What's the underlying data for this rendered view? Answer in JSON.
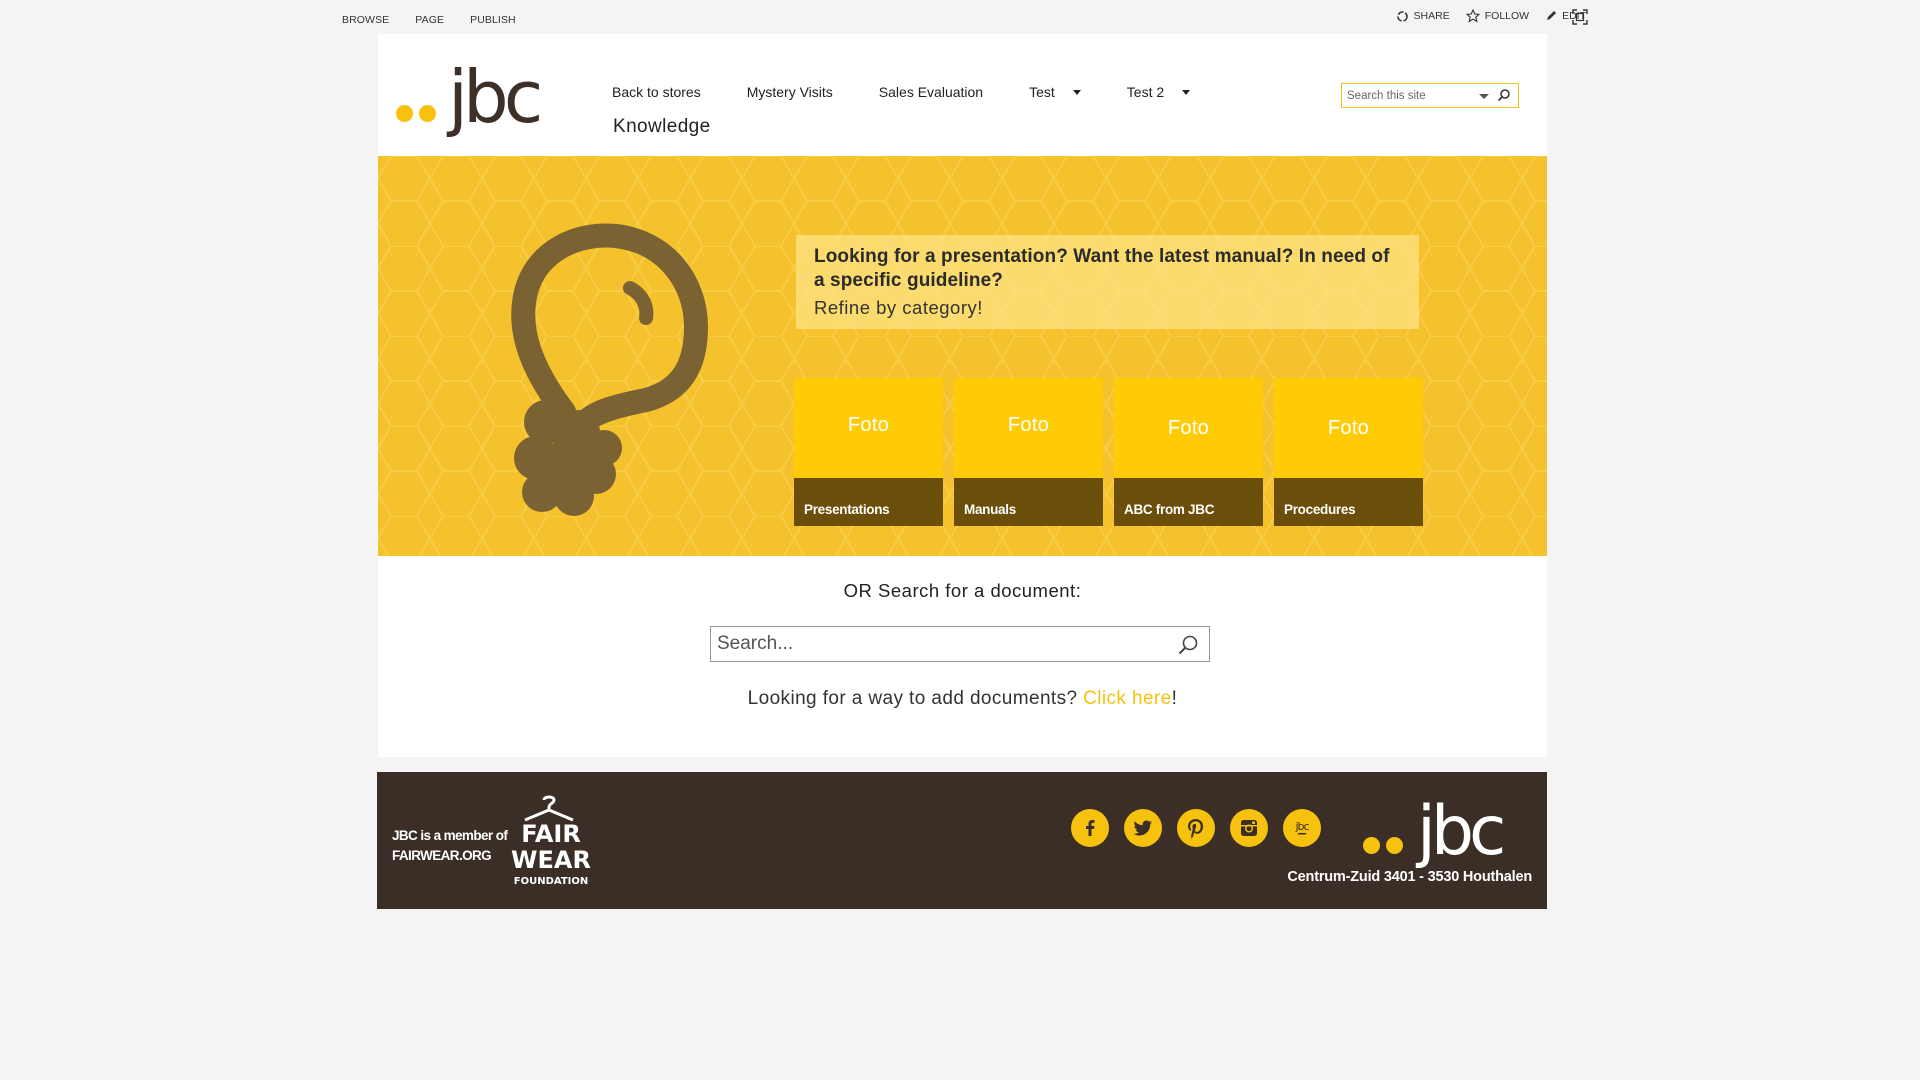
{
  "ribbon": {
    "tabs": [
      "BROWSE",
      "PAGE",
      "PUBLISH"
    ],
    "share_label": "SHARE",
    "follow_label": "FOLLOW",
    "edit_label": "EDIT"
  },
  "header": {
    "logo_text": "jbc",
    "nav": {
      "back_to_stores": "Back to stores",
      "mystery_visits": "Mystery Visits",
      "sales_evaluation": "Sales Evaluation",
      "test": "Test",
      "test2": "Test 2",
      "knowledge": "Knowledge"
    },
    "search": {
      "placeholder": "Search this site"
    }
  },
  "hero": {
    "info_title": "Looking for a presentation? Want the latest manual? In need of a specific guideline?",
    "info_sub": "Refine by category!",
    "tiles": [
      {
        "photo_label": "Foto",
        "label": "Presentations"
      },
      {
        "photo_label": "Foto",
        "label": "Manuals"
      },
      {
        "photo_label": "Foto",
        "label": "ABC from JBC"
      },
      {
        "photo_label": "Foto",
        "label": "Procedures"
      }
    ]
  },
  "doc_search": {
    "heading": "OR Search for a document:",
    "placeholder": "Search...",
    "add_prefix": "Looking for a way to add documents? ",
    "add_link": "Click here",
    "add_suffix": "!"
  },
  "footer": {
    "member_line1": "JBC is a member of",
    "member_line2": "FAIRWEAR.ORG",
    "fairwear_logo": [
      "FAIR",
      "WEAR",
      "FOUNDATION"
    ],
    "logo_text": "jbc",
    "address": "Centrum-Zuid 3401 - 3530 Houthalen",
    "socials": [
      "facebook-icon",
      "twitter-icon",
      "pinterest-icon",
      "instagram-icon",
      "jbc-blog-icon"
    ],
    "jbc_blog_label": "jbc"
  },
  "colors": {
    "brand_yellow": "#f7c20d",
    "hero_yellow": "#f5c22e",
    "tile_yellow": "#ffcb05",
    "tile_bar_brown": "#6b4e0a",
    "footer_brown": "#3a2e26"
  }
}
